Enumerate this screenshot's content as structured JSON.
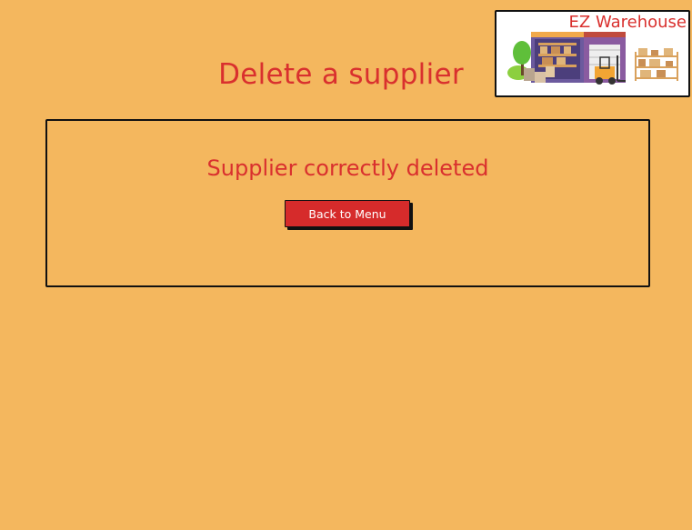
{
  "page": {
    "title": "Delete a supplier"
  },
  "logo": {
    "text": "EZ Warehouse",
    "image_icon": "warehouse-illustration"
  },
  "result": {
    "message": "Supplier correctly deleted",
    "back_button_label": "Back to Menu"
  },
  "colors": {
    "background": "#f4b75e",
    "accent": "#d9302e",
    "button": "#d62b2b"
  }
}
